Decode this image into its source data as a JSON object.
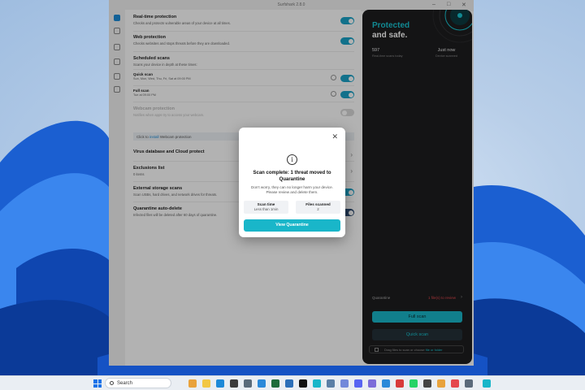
{
  "window": {
    "title": "Surfshark 2.8.0"
  },
  "settings": {
    "realtime": {
      "title": "Real-time protection",
      "desc": "Checks and protects vulnerable areas of your device at all times."
    },
    "web": {
      "title": "Web protection",
      "desc": "Checks websites and stops threats before they are downloaded."
    },
    "scheduled": {
      "title": "Scheduled scans",
      "desc": "Scans your device in depth at these times:"
    },
    "quick": {
      "title": "Quick scan",
      "desc": "Sun, Mon, Wed, Thu, Fri, Sat at 09:00 PM"
    },
    "full": {
      "title": "Full scan",
      "desc": "Tue at 09:00 PM"
    },
    "webcam": {
      "title": "Webcam protection",
      "desc": "Notifies when apps try to access your webcam."
    },
    "webcam_notice": {
      "prefix": "Click to",
      "link": "install",
      "suffix": "Webcam protection"
    },
    "virus_db": {
      "title": "Virus database and Cloud protect"
    },
    "exclusions": {
      "title": "Exclusions list",
      "desc": "0 items"
    },
    "external": {
      "title": "External storage scans",
      "desc": "Scan USBs, hard drives, and network drives for threats."
    },
    "quarantine": {
      "title": "Quarantine auto-delete",
      "desc": "Infected files will be deleted after 60 days of quarantine."
    }
  },
  "panel": {
    "title_line1": "Protected",
    "title_line2": "and safe.",
    "stat1": {
      "value": "597",
      "label": "Real-time scans today"
    },
    "stat2": {
      "value": "Just now",
      "label": "Device scanned"
    },
    "quarantine_label": "Quarantine",
    "quarantine_value": "1 file(s) to review",
    "full_scan": "Full scan",
    "quick_scan": "Quick scan",
    "drop_text": "Drag files to scan or choose",
    "drop_link": "file or folder"
  },
  "modal": {
    "title": "Scan complete: 1 threat moved to Quarantine",
    "desc": "Don't worry, they can no longer harm your device. Please review and delete them.",
    "scan_time_label": "Scan time",
    "scan_time_value": "Less than 1min",
    "files_label": "Files scanned",
    "files_value": "2",
    "button": "View Quarantine"
  },
  "taskbar": {
    "search_placeholder": "Search"
  },
  "colors": {
    "accent": "#19b6c9",
    "danger": "#e5484d",
    "panel_bg": "#1d1d1f"
  }
}
